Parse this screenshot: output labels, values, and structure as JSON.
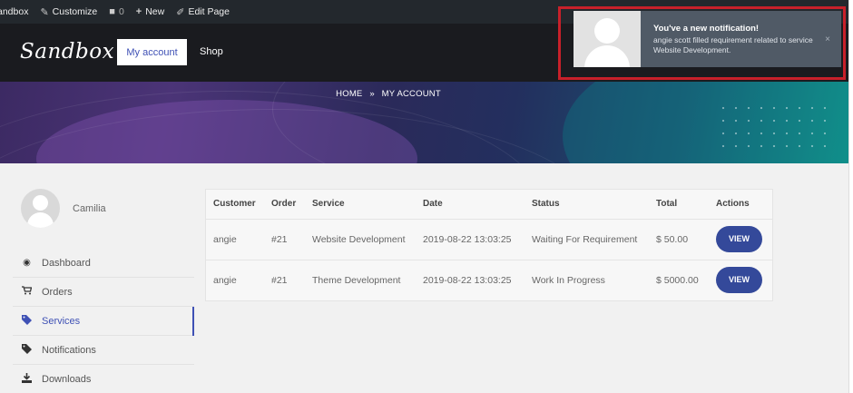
{
  "adminbar": {
    "site": "Sandbox",
    "customize": "Customize",
    "comments_count": "0",
    "new": "New",
    "edit_page": "Edit Page"
  },
  "header": {
    "logo": "Sandbox",
    "nav": {
      "my_account": "My account",
      "shop": "Shop"
    }
  },
  "notification": {
    "title": "You've a new notification!",
    "message": "angie scott filled requirement related to service Website Development.",
    "close": "×",
    "highlight_color": "#c8202a"
  },
  "breadcrumb": {
    "home": "HOME",
    "separator": "»",
    "current": "MY ACCOUNT"
  },
  "profile": {
    "name": "Camilia"
  },
  "menu": [
    {
      "label": "Dashboard",
      "icon": "dashboard-icon"
    },
    {
      "label": "Orders",
      "icon": "cart-icon"
    },
    {
      "label": "Services",
      "icon": "tag-icon",
      "active": true
    },
    {
      "label": "Notifications",
      "icon": "tag-icon"
    },
    {
      "label": "Downloads",
      "icon": "download-icon"
    }
  ],
  "table": {
    "headers": [
      "Customer",
      "Order",
      "Service",
      "Date",
      "Status",
      "Total",
      "Actions"
    ],
    "rows": [
      {
        "customer": "angie",
        "order": "#21",
        "service": "Website Development",
        "date": "2019-08-22 13:03:25",
        "status": "Waiting For Requirement",
        "total": "$ 50.00",
        "action": "VIEW"
      },
      {
        "customer": "angie",
        "order": "#21",
        "service": "Theme Development",
        "date": "2019-08-22 13:03:25",
        "status": "Work In Progress",
        "total": "$ 5000.00",
        "action": "VIEW"
      }
    ]
  },
  "colors": {
    "accent": "#3f51b5",
    "button": "#34499a",
    "adminbar": "#23282d",
    "header": "#1a1b1f"
  }
}
